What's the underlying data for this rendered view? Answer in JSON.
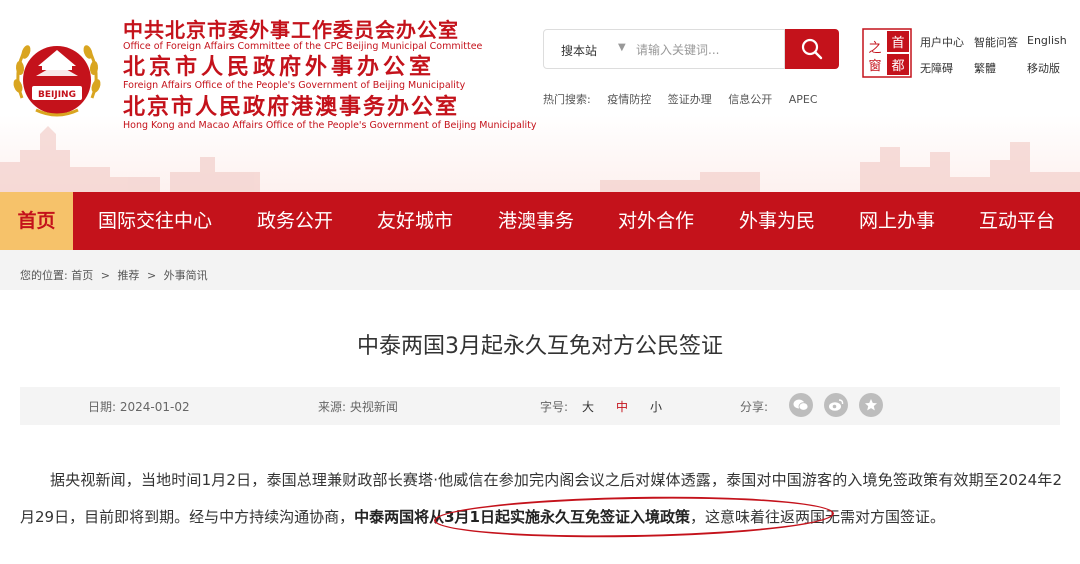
{
  "header": {
    "titles": [
      {
        "cn": "中共北京市委外事工作委员会办公室",
        "en": "Office of Foreign Affairs Committee of the CPC Beijing Municipal Committee"
      },
      {
        "cn": "北京市人民政府外事办公室",
        "en": "Foreign Affairs Office of the People's Government of Beijing Municipality"
      },
      {
        "cn": "北京市人民政府港澳事务办公室",
        "en": "Hong Kong and Macao Affairs Office of the People's Government of Beijing Municipality"
      }
    ],
    "emblem_text": "BEIJING",
    "capital_logo_chars": [
      "首",
      "都",
      "之",
      "窗"
    ]
  },
  "search": {
    "scope_label": "搜本站",
    "placeholder": "请输入关键词...",
    "hot_label": "热门搜索:",
    "hot_keywords": [
      "疫情防控",
      "签证办理",
      "信息公开",
      "APEC"
    ]
  },
  "utility_links": [
    "用户中心",
    "智能问答",
    "English",
    "无障碍",
    "繁體",
    "移动版"
  ],
  "nav": {
    "items": [
      "首页",
      "国际交往中心",
      "政务公开",
      "友好城市",
      "港澳事务",
      "对外合作",
      "外事为民",
      "网上办事",
      "互动平台"
    ],
    "active_index": 0
  },
  "breadcrumb": {
    "prefix": "您的位置:",
    "items": [
      "首页",
      "推荐",
      "外事简讯"
    ],
    "separator": ">"
  },
  "article": {
    "title": "中泰两国3月起永久互免对方公民签证",
    "date_label": "日期:",
    "date": "2024-01-02",
    "source_label": "来源:",
    "source": "央视新闻",
    "font_size_label": "字号:",
    "font_sizes": [
      "大",
      "中",
      "小"
    ],
    "active_font_size": "中",
    "share_label": "分享:",
    "share_icons": [
      "wechat-icon",
      "weibo-icon",
      "favorite-icon"
    ],
    "body_before": "据央视新闻，当地时间1月2日，泰国总理兼财政部长赛塔·他威信在参加完内阁会议之后对媒体透露，泰国对中国游客的入境免签政策有效期至2024年2月29日，目前即将到期。经与中方持续沟通协商，",
    "body_highlight": "中泰两国将从3月1日起实施永久互免签证入境政策",
    "body_after": "，这意味着往返两国无需对方国签证。"
  },
  "colors": {
    "brand_red": "#c4121b",
    "nav_active_bg": "#f6c26a",
    "annotation_red": "#c4121b"
  }
}
